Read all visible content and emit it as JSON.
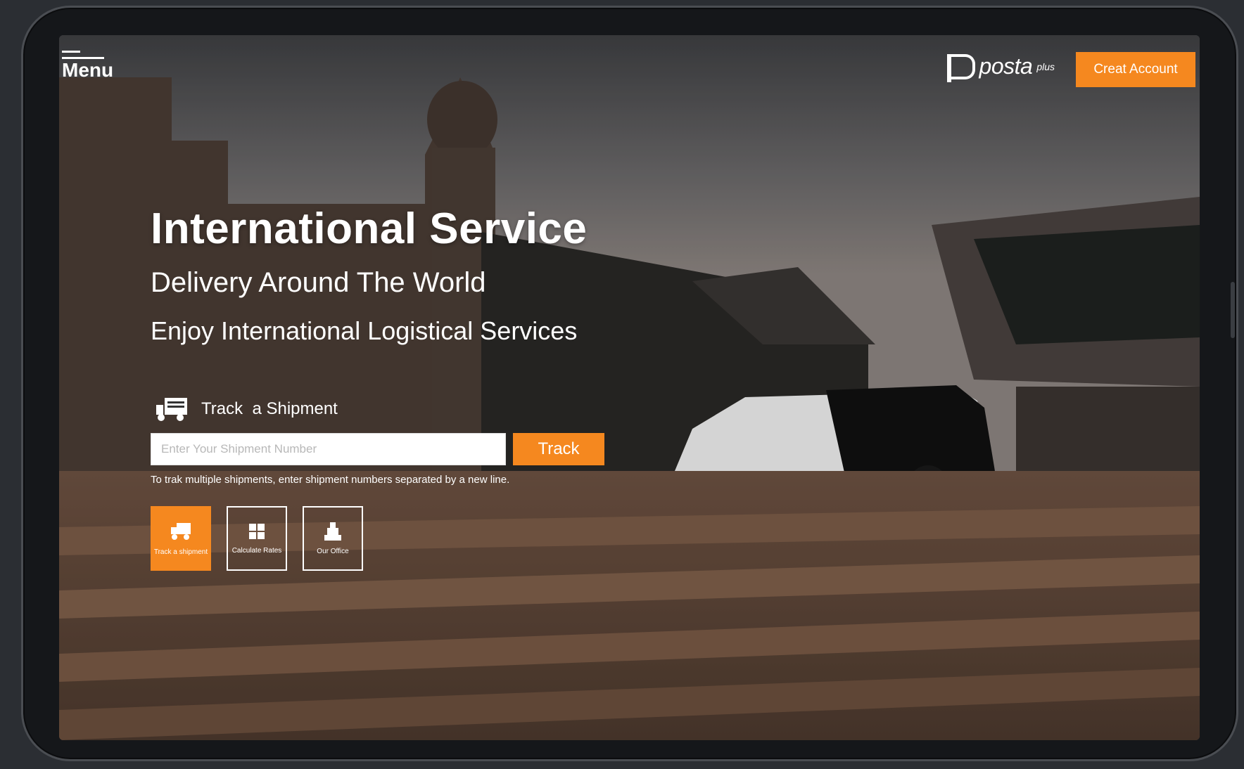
{
  "header": {
    "menu_label": "Menu",
    "logo_text": "posta",
    "logo_superscript": "plus",
    "create_account_label": "Creat Account"
  },
  "hero": {
    "title": "International Service",
    "subtitle": "Delivery Around The World",
    "tagline": "Enjoy International Logistical Services"
  },
  "tracking": {
    "heading": "Track  a Shipment",
    "input_placeholder": "Enter Your Shipment Number",
    "input_value": "",
    "track_button_label": "Track",
    "hint": "To trak multiple shipments, enter shipment numbers separated by a new line."
  },
  "quick_actions": [
    {
      "label": "Track a shipment",
      "icon": "truck-icon",
      "active": true
    },
    {
      "label": "Calculate Rates",
      "icon": "calculator-icon",
      "active": false
    },
    {
      "label": "Our Office",
      "icon": "office-icon",
      "active": false
    }
  ],
  "colors": {
    "accent": "#f5881f",
    "text_on_dark": "#ffffff",
    "frame": "#15171a"
  }
}
